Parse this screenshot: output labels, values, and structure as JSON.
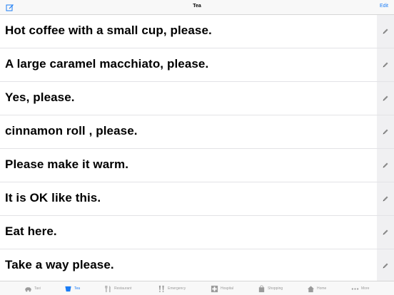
{
  "navbar": {
    "compose_icon": "compose-icon",
    "title": "Tea",
    "edit_label": "Edit"
  },
  "phrases": [
    {
      "text": "Hot coffee with a small cup, please."
    },
    {
      "text": "A large caramel macchiato, please."
    },
    {
      "text": "Yes, please."
    },
    {
      "text": "cinnamon roll , please."
    },
    {
      "text": "Please make it warm."
    },
    {
      "text": "It is OK like this."
    },
    {
      "text": "Eat here."
    },
    {
      "text": "Take a way please."
    }
  ],
  "tabs": [
    {
      "label": "Taxi",
      "icon": "taxi-icon",
      "active": false
    },
    {
      "label": "Tea",
      "icon": "tea-icon",
      "active": true
    },
    {
      "label": "Restaurant",
      "icon": "fork-knife-icon",
      "active": false
    },
    {
      "label": "Emergency",
      "icon": "exclamation-icon",
      "active": false
    },
    {
      "label": "Hospital",
      "icon": "hospital-cross-icon",
      "active": false
    },
    {
      "label": "Shopping",
      "icon": "shopping-bag-icon",
      "active": false
    },
    {
      "label": "Home",
      "icon": "home-icon",
      "active": false
    },
    {
      "label": "More",
      "icon": "more-dots-icon",
      "active": false
    }
  ],
  "colors": {
    "accent": "#1a7cf5",
    "inactive": "#9a9a9a",
    "bar_background": "#f8f8f8",
    "edit_column": "#f0f0f2"
  }
}
